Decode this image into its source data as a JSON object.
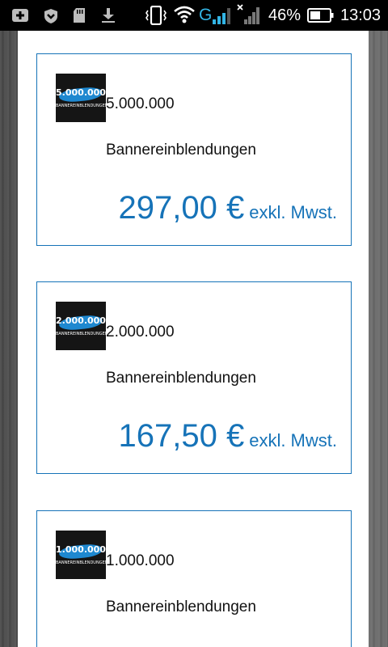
{
  "status_bar": {
    "battery_percent": "46%",
    "time": "13:03",
    "network": "G",
    "icons": [
      "add-icon",
      "shield-icon",
      "sd-card-icon",
      "download-icon",
      "vibrate-icon",
      "wifi-icon",
      "signal-icon",
      "no-signal-icon",
      "battery-icon"
    ]
  },
  "packages": [
    {
      "thumb_number": "5.000.000",
      "thumb_text": "BANNEREINBLENDUNGEN",
      "count": "5.000.000",
      "unit": "Bannereinblendungen",
      "price": "297,00 €",
      "tax_note": "exkl. Mwst."
    },
    {
      "thumb_number": "2.000.000",
      "thumb_text": "BANNEREINBLENDUNGEN",
      "count": "2.000.000",
      "unit": "Bannereinblendungen",
      "price": "167,50 €",
      "tax_note": "exkl. Mwst."
    },
    {
      "thumb_number": "1.000.000",
      "thumb_text": "BANNEREINBLENDUNGEN",
      "count": "1.000.000",
      "unit": "Bannereinblendungen",
      "price": "",
      "tax_note": ""
    }
  ],
  "colors": {
    "accent": "#1673b8",
    "status_bar": "#000000",
    "signal_blue": "#33b5e5"
  }
}
